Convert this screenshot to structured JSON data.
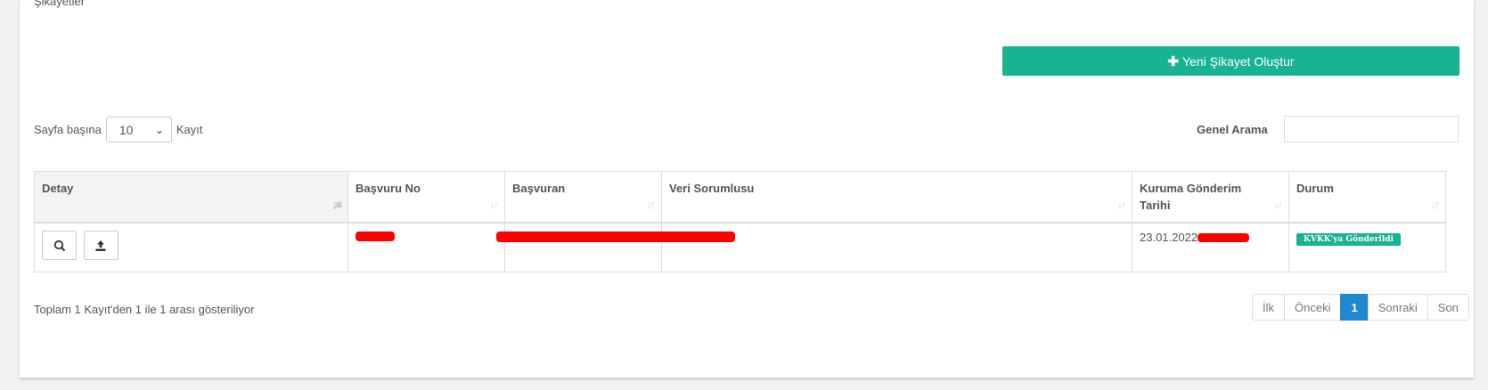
{
  "header": {
    "partial_text": "Şikayetler"
  },
  "actions": {
    "new_complaint_label": "Yeni Şikayet Oluştur",
    "new_complaint_icon": "plus-icon"
  },
  "length": {
    "prefix": "Sayfa başına",
    "value": "10",
    "suffix": "Kayıt"
  },
  "search": {
    "label": "Genel Arama",
    "value": ""
  },
  "table": {
    "columns": [
      "Detay",
      "Başvuru No",
      "Başvuran",
      "Veri Sorumlusu",
      "Kuruma Gönderim Tarihi",
      "Durum"
    ],
    "rows": [
      {
        "date": "23.01.2022",
        "status": "KVKK'ya Gönderildi"
      }
    ]
  },
  "info": "Toplam 1 Kayıt'den 1 ile 1 arası gösteriliyor",
  "pagination": {
    "first": "İlk",
    "prev": "Önceki",
    "current": "1",
    "next": "Sonraki",
    "last": "Son"
  },
  "colors": {
    "accent": "#17b392",
    "page_active": "#1e88d0",
    "redaction": "#ff0000"
  }
}
